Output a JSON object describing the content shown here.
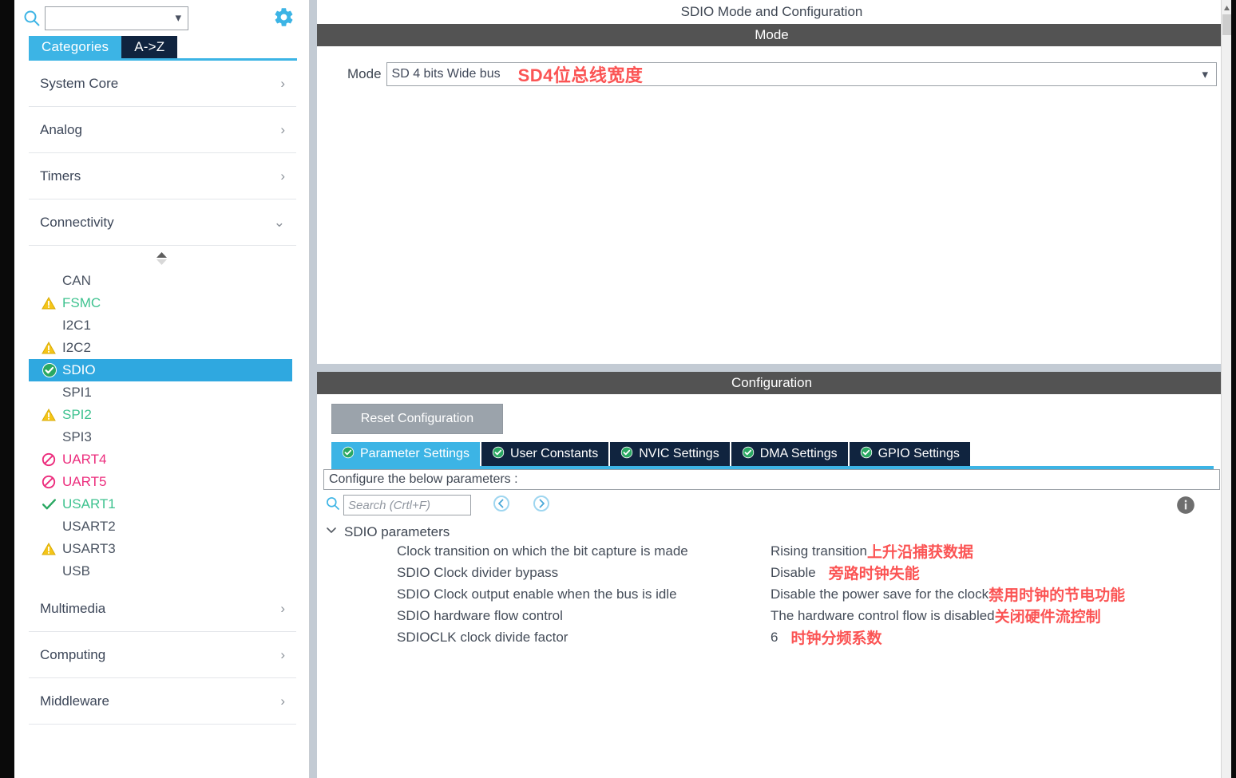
{
  "sidebar": {
    "search": {
      "value": "",
      "placeholder": ""
    },
    "icons": {
      "search": "search-icon",
      "gear": "gear-icon",
      "chevron_down": "chevron-down-icon"
    },
    "tabs": [
      {
        "label": "Categories",
        "selected": true
      },
      {
        "label": "A->Z",
        "selected": false
      }
    ],
    "categories_top": [
      {
        "label": "System Core",
        "expanded": false,
        "chevron": "›"
      },
      {
        "label": "Analog",
        "expanded": false,
        "chevron": "›"
      },
      {
        "label": "Timers",
        "expanded": false,
        "chevron": "›"
      },
      {
        "label": "Connectivity",
        "expanded": true,
        "chevron": "⌄"
      }
    ],
    "peripherals": [
      {
        "label": "CAN",
        "status": "none",
        "selected": false
      },
      {
        "label": "FSMC",
        "status": "warning",
        "selected": false
      },
      {
        "label": "I2C1",
        "status": "none",
        "selected": false
      },
      {
        "label": "I2C2",
        "status": "warning",
        "selected": false
      },
      {
        "label": "SDIO",
        "status": "ok-circle",
        "selected": true
      },
      {
        "label": "SPI1",
        "status": "none",
        "selected": false
      },
      {
        "label": "SPI2",
        "status": "warning",
        "selected": false
      },
      {
        "label": "SPI3",
        "status": "none",
        "selected": false
      },
      {
        "label": "UART4",
        "status": "blocked",
        "selected": false
      },
      {
        "label": "UART5",
        "status": "blocked",
        "selected": false
      },
      {
        "label": "USART1",
        "status": "check",
        "selected": false
      },
      {
        "label": "USART2",
        "status": "none",
        "selected": false
      },
      {
        "label": "USART3",
        "status": "warning",
        "selected": false
      },
      {
        "label": "USB",
        "status": "none",
        "selected": false
      }
    ],
    "categories_bottom": [
      {
        "label": "Multimedia",
        "chevron": "›"
      },
      {
        "label": "Computing",
        "chevron": "›"
      },
      {
        "label": "Middleware",
        "chevron": "›"
      }
    ]
  },
  "main": {
    "title": "SDIO Mode and Configuration",
    "mode_section": {
      "header": "Mode",
      "mode_label": "Mode",
      "mode_value": "SD 4 bits Wide bus",
      "mode_annotation": "SD4位总线宽度"
    },
    "config_section": {
      "header": "Configuration",
      "reset_button": "Reset Configuration",
      "tabs": [
        {
          "label": "Parameter Settings",
          "selected": true
        },
        {
          "label": "User Constants",
          "selected": false
        },
        {
          "label": "NVIC Settings",
          "selected": false
        },
        {
          "label": "DMA Settings",
          "selected": false
        },
        {
          "label": "GPIO Settings",
          "selected": false
        }
      ],
      "note": "Configure the below parameters :",
      "search_placeholder": "Search (Crtl+F)",
      "search_value": "",
      "group_label": "SDIO parameters",
      "group_expanded": true,
      "parameters": [
        {
          "name": "Clock transition on which the bit capture is made",
          "value": "Rising transition",
          "annotation": "上升沿捕获数据",
          "annotation_space": false
        },
        {
          "name": "SDIO Clock divider bypass",
          "value": "Disable",
          "annotation": "旁路时钟失能",
          "annotation_space": true
        },
        {
          "name": "SDIO Clock output enable when the bus is idle",
          "value": "Disable the power save for the clock",
          "annotation": "禁用时钟的节电功能",
          "annotation_space": false
        },
        {
          "name": "SDIO hardware flow control",
          "value": "The hardware control flow is disabled",
          "annotation": "关闭硬件流控制",
          "annotation_space": false
        },
        {
          "name": "SDIOCLK clock divide factor",
          "value": "6",
          "annotation": "时钟分频系数",
          "annotation_space": true
        }
      ]
    }
  },
  "colors": {
    "accent_blue": "#3cb4e5",
    "tab_dark": "#10243f",
    "header_gray": "#535353",
    "annotation_red": "#fb5454",
    "ok_green": "#3ec28f",
    "warning_yellow": "#f5c518",
    "blocked_pink": "#ec2d7d",
    "splitter_gray": "#c3cbd4"
  }
}
